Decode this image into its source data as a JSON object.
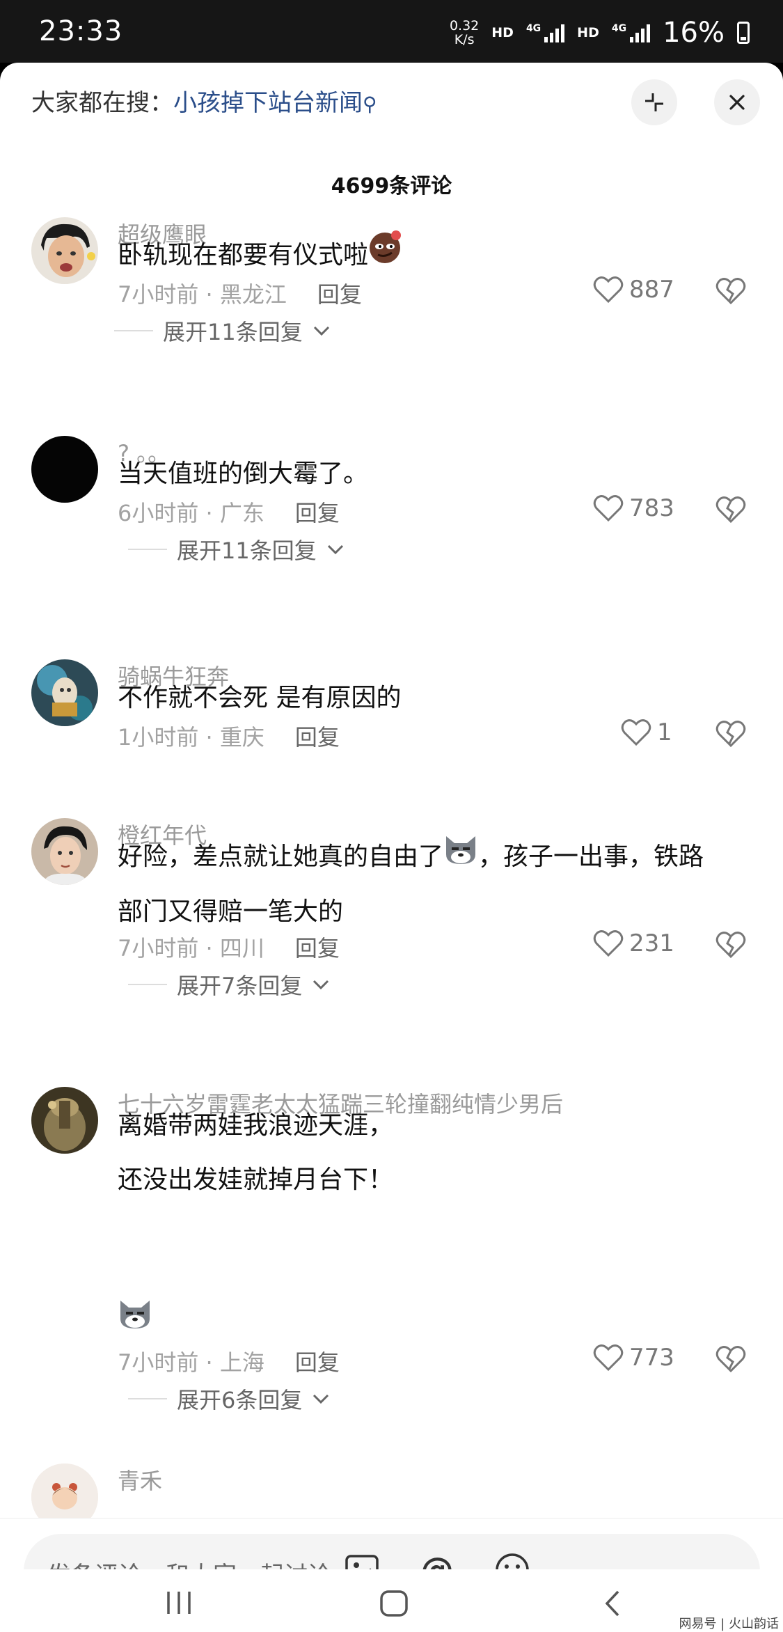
{
  "status_bar": {
    "time": "23:33",
    "speed_value": "0.32",
    "speed_unit": "K/s",
    "hd1": "HD",
    "net1": "4G",
    "hd2": "HD",
    "net2": "4G",
    "battery": "16%"
  },
  "header": {
    "search_prefix": "大家都在搜：",
    "search_keyword": "小孩掉下站台新闻"
  },
  "comment_count": "4699条评论",
  "comments": [
    {
      "username": "超级鹰眼",
      "lines": [
        "卧轨现在都要有仪式啦"
      ],
      "time_location": "7小时前 · 黑龙江",
      "reply": "回复",
      "likes": "887",
      "expand": "展开11条回复"
    },
    {
      "username": "? 。。",
      "lines": [
        "当天值班的倒大霉了。"
      ],
      "time_location": "6小时前 · 广东",
      "reply": "回复",
      "likes": "783",
      "expand": "展开11条回复"
    },
    {
      "username": "骑蜗牛狂奔",
      "lines": [
        "不作就不会死 是有原因的"
      ],
      "time_location": "1小时前 · 重庆",
      "reply": "回复",
      "likes": "1"
    },
    {
      "username": "橙红年代",
      "lines": [
        "好险，差点就让她真的自由了",
        "，孩子一出事，铁路",
        "部门又得赔一笔大的"
      ],
      "time_location": "7小时前 · 四川",
      "reply": "回复",
      "likes": "231",
      "expand": "展开7条回复"
    },
    {
      "username": "七十六岁雷霆老太太猛踹三轮撞翻纯情少男后",
      "lines": [
        "离婚带两娃我浪迹天涯，",
        "还没出发娃就掉月台下！"
      ],
      "time_location": "7小时前 · 上海",
      "reply": "回复",
      "likes": "773",
      "expand": "展开6条回复"
    },
    {
      "username": "青禾"
    }
  ],
  "input": {
    "placeholder": "发条评论，和大家一起讨论"
  },
  "watermark": "网易号 | 火山韵话",
  "colors": {
    "keyword": "#2b4e8a",
    "meta": "#a2a2a2",
    "username": "#9a9a9a"
  }
}
